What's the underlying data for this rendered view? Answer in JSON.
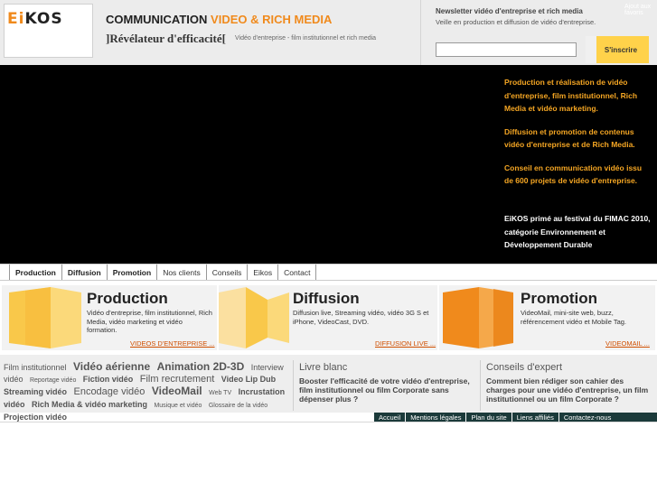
{
  "header": {
    "logo": "EiKOS",
    "tagline_main": "COMMUNICATION",
    "tagline_accent": "VIDEO & RICH MEDIA",
    "slogan": "]Révélateur d'efficacité[",
    "slogan_sub": "Vidéo d'entreprise - film institutionnel et rich media"
  },
  "newsletter": {
    "title": "Newsletter vidéo d'entreprise et rich media",
    "subtitle": "Veille en production et diffusion de vidéo d'entreprise.",
    "top_link": "Ajout aux favoris",
    "email_value": "",
    "email_placeholder": "",
    "button_label": "S'inscrire"
  },
  "hero": {
    "paragraphs": [
      "Production et réalisation de vidéo d'entreprise, film institutionnel, Rich Media et vidéo marketing.",
      "Diffusion et promotion de contenus vidéo d'entreprise et de Rich Media.",
      "Conseil en communication vidéo issu de 600 projets de vidéo d'entreprise."
    ],
    "award": "EiKOS primé au festival du FIMAC 2010, catégorie Environnement et Développement Durable"
  },
  "nav": [
    {
      "label": "Production",
      "bold": true
    },
    {
      "label": "Diffusion",
      "bold": true
    },
    {
      "label": "Promotion",
      "bold": true
    },
    {
      "label": "Nos clients",
      "bold": false
    },
    {
      "label": "Conseils",
      "bold": false
    },
    {
      "label": "Eikos",
      "bold": false
    },
    {
      "label": "Contact",
      "bold": false
    }
  ],
  "services": [
    {
      "title": "Production",
      "desc": "Vidéo d'entreprise, film institutionnel, Rich Media, vidéo marketing et vidéo formation.",
      "link": "VIDEOS D'ENTREPRISE ...",
      "color": "#f9c84a"
    },
    {
      "title": "Diffusion",
      "desc": "Diffusion live, Streaming vidéo, vidéo 3G S et iPhone, VideoCast, DVD.",
      "link": "DIFFUSION LIVE ...",
      "color": "#f9d57a"
    },
    {
      "title": "Promotion",
      "desc": "VideoMail, mini-site web, buzz, référencement vidéo et Mobile Tag.",
      "link": "VIDEOMAIL ...",
      "color": "#f08a1c"
    }
  ],
  "tagcloud": [
    {
      "text": "Film institutionnel",
      "size": "m",
      "bold": false
    },
    {
      "text": "Vidéo aérienne",
      "size": "xl",
      "bold": true
    },
    {
      "text": "Animation 2D-3D",
      "size": "xl",
      "bold": true
    },
    {
      "text": "Interview vidéo",
      "size": "m",
      "bold": false
    },
    {
      "text": "Reportage vidéo",
      "size": "s",
      "bold": false
    },
    {
      "text": "Fiction vidéo",
      "size": "m",
      "bold": true
    },
    {
      "text": "Film recrutement",
      "size": "l",
      "bold": false
    },
    {
      "text": "Video Lip Dub",
      "size": "m",
      "bold": true
    },
    {
      "text": "Streaming vidéo",
      "size": "m",
      "bold": true
    },
    {
      "text": "Encodage vidéo",
      "size": "l",
      "bold": false
    },
    {
      "text": "VideoMail",
      "size": "xl",
      "bold": true
    },
    {
      "text": "Web TV",
      "size": "s",
      "bold": false
    },
    {
      "text": "Incrustation vidéo",
      "size": "m",
      "bold": true
    },
    {
      "text": "Rich Media & vidéo marketing",
      "size": "m",
      "bold": true
    },
    {
      "text": "Musique et vidéo",
      "size": "s",
      "bold": false
    },
    {
      "text": "Glossaire de la vidéo",
      "size": "s",
      "bold": false
    },
    {
      "text": "Projection vidéo",
      "size": "m",
      "bold": true
    }
  ],
  "livre_blanc": {
    "title": "Livre blanc",
    "text": "Booster l'efficacité de votre vidéo d'entreprise, film institutionnel ou film Corporate sans dépenser plus ?"
  },
  "conseils": {
    "title": "Conseils d'expert",
    "text": "Comment bien rédiger son cahier des charges pour une vidéo d'entreprise, un film institutionnel ou un film Corporate ?"
  },
  "footer": [
    "Accueil",
    "Mentions légales",
    "Plan du site",
    "Liens affiliés",
    "Contactez-nous"
  ]
}
